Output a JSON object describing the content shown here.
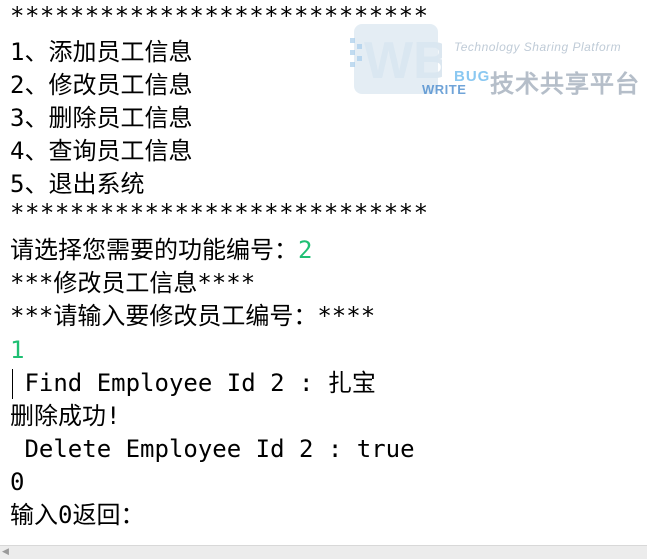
{
  "console": {
    "stars_top": "****************************",
    "menu": [
      "1、添加员工信息",
      "2、修改员工信息",
      "3、删除员工信息",
      "4、查询员工信息",
      "5、退出系统"
    ],
    "stars_bottom": "****************************",
    "prompt_select": "请选择您需要的功能编号：",
    "input_select": "2",
    "header_modify": "***修改员工信息****",
    "prompt_id": "***请输入要修改员工编号：****",
    "input_id": "1",
    "find_line": " Find Employee Id 2 : 扎宝",
    "delete_success": "删除成功!",
    "delete_line": " Delete Employee Id 2 : true",
    "zero_line": "0",
    "prompt_return": "输入0返回："
  },
  "watermark": {
    "logo_text": "WB",
    "tagline": "Technology Sharing Platform",
    "bug": "BUG",
    "write": "WRITE",
    "cn": "技术共享平台"
  }
}
